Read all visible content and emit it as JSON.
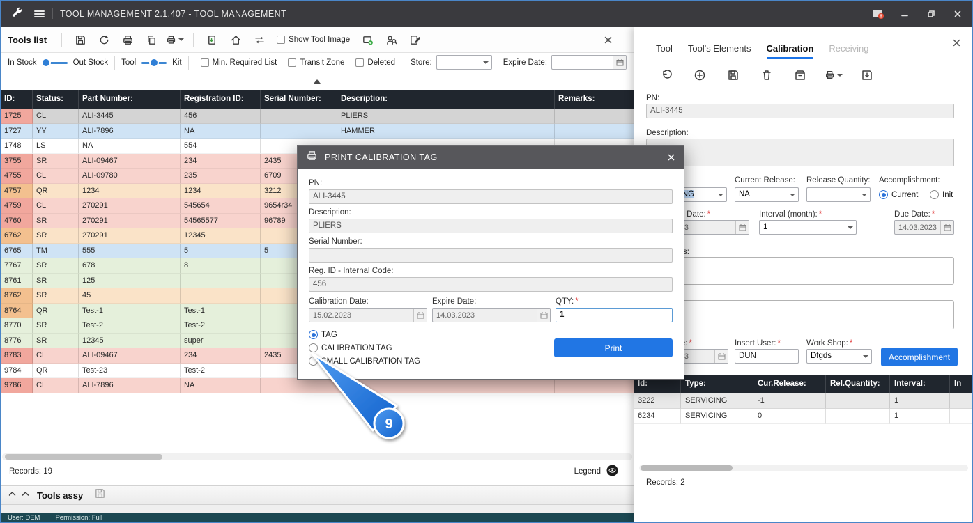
{
  "window": {
    "title": "TOOL MANAGEMENT 2.1.407 - TOOL MANAGEMENT",
    "status_user": "User: DEM",
    "status_permission": "Permission: Full"
  },
  "misc": {
    "star": "*"
  },
  "tools_panel": {
    "title": "Tools list",
    "show_tool_image": "Show Tool Image",
    "filters": {
      "in_stock": "In Stock",
      "out_stock": "Out Stock",
      "tool": "Tool",
      "kit": "Kit",
      "min_required": "Min. Required List",
      "transit_zone": "Transit Zone",
      "deleted": "Deleted",
      "store_label": "Store:",
      "store_value": "",
      "expire_label": "Expire Date:",
      "expire_value": ""
    },
    "records": "Records: 19",
    "legend": "Legend",
    "assy_title": "Tools assy"
  },
  "tools_table": {
    "columns": [
      "ID:",
      "Status:",
      "Part Number:",
      "Registration ID:",
      "Serial Number:",
      "Description:",
      "Remarks:"
    ],
    "rows": [
      {
        "id": "1725",
        "status": "CL",
        "part": "ALI-3445",
        "reg": "456",
        "serial": "",
        "desc": "PLIERS",
        "remarks": "",
        "tone": "selected",
        "id_tone": "salmon"
      },
      {
        "id": "1727",
        "status": "YY",
        "part": "ALI-7896",
        "reg": "NA",
        "serial": "",
        "desc": "HAMMER",
        "remarks": "",
        "tone": "blue",
        "id_tone": "same"
      },
      {
        "id": "1748",
        "status": "LS",
        "part": "NA",
        "reg": "554",
        "serial": "",
        "desc": "",
        "remarks": "",
        "tone": "white",
        "id_tone": "same"
      },
      {
        "id": "3755",
        "status": "SR",
        "part": "ALI-09467",
        "reg": "234",
        "serial": "2435",
        "desc": "",
        "remarks": "",
        "tone": "pink",
        "id_tone": "salmon"
      },
      {
        "id": "4755",
        "status": "CL",
        "part": "ALI-09780",
        "reg": "235",
        "serial": "6709",
        "desc": "",
        "remarks": "",
        "tone": "pink",
        "id_tone": "salmon"
      },
      {
        "id": "4757",
        "status": "QR",
        "part": "1234",
        "reg": "1234",
        "serial": "3212",
        "desc": "",
        "remarks": "",
        "tone": "orange",
        "id_tone": "orange"
      },
      {
        "id": "4759",
        "status": "CL",
        "part": "270291",
        "reg": "545654",
        "serial": "9654r34",
        "desc": "",
        "remarks": "",
        "tone": "pink",
        "id_tone": "salmon"
      },
      {
        "id": "4760",
        "status": "SR",
        "part": "270291",
        "reg": "54565577",
        "serial": "96789",
        "desc": "",
        "remarks": "",
        "tone": "pink",
        "id_tone": "salmon"
      },
      {
        "id": "6762",
        "status": "SR",
        "part": "270291",
        "reg": "12345",
        "serial": "",
        "desc": "",
        "remarks": "",
        "tone": "orange",
        "id_tone": "orange"
      },
      {
        "id": "6765",
        "status": "TM",
        "part": "555",
        "reg": "5",
        "serial": "5",
        "desc": "",
        "remarks": "",
        "tone": "blue",
        "id_tone": "same"
      },
      {
        "id": "7767",
        "status": "SR",
        "part": "678",
        "reg": "8",
        "serial": "",
        "desc": "",
        "remarks": "",
        "tone": "green",
        "id_tone": "same"
      },
      {
        "id": "8761",
        "status": "SR",
        "part": "125",
        "reg": "",
        "serial": "",
        "desc": "",
        "remarks": "",
        "tone": "green",
        "id_tone": "same"
      },
      {
        "id": "8762",
        "status": "SR",
        "part": "45",
        "reg": "",
        "serial": "",
        "desc": "",
        "remarks": "",
        "tone": "orange",
        "id_tone": "orange"
      },
      {
        "id": "8764",
        "status": "QR",
        "part": "Test-1",
        "reg": "Test-1",
        "serial": "",
        "desc": "",
        "remarks": "",
        "tone": "green",
        "id_tone": "orange"
      },
      {
        "id": "8770",
        "status": "SR",
        "part": "Test-2",
        "reg": "Test-2",
        "serial": "",
        "desc": "",
        "remarks": "",
        "tone": "green",
        "id_tone": "same"
      },
      {
        "id": "8776",
        "status": "SR",
        "part": "12345",
        "reg": "super",
        "serial": "",
        "desc": "",
        "remarks": "",
        "tone": "green",
        "id_tone": "same"
      },
      {
        "id": "8783",
        "status": "CL",
        "part": "ALI-09467",
        "reg": "234",
        "serial": "2435",
        "desc": "",
        "remarks": "",
        "tone": "pink",
        "id_tone": "salmon"
      },
      {
        "id": "9784",
        "status": "QR",
        "part": "Test-23",
        "reg": "Test-2",
        "serial": "",
        "desc": "",
        "remarks": "",
        "tone": "white",
        "id_tone": "same"
      },
      {
        "id": "9786",
        "status": "CL",
        "part": "ALI-7896",
        "reg": "NA",
        "serial": "",
        "desc": "",
        "remarks": "",
        "tone": "pink",
        "id_tone": "salmon"
      }
    ]
  },
  "detail_panel": {
    "tabs": [
      "Tool",
      "Tool's Elements",
      "Calibration",
      "Receiving"
    ],
    "active_tab": "Calibration",
    "pn_label": "PN:",
    "pn_value": "ALI-3445",
    "description_label": "Description:",
    "description_value": "",
    "type_value": "SERVICING",
    "current_release_label": "Current Release:",
    "current_release_value": "NA",
    "release_quantity_label": "Release Quantity:",
    "release_quantity_value": "",
    "accomplishment_label": "Accomplishment:",
    "radio_current": "Current",
    "radio_init": "Init",
    "calibration_date_label": "Calibration Date:",
    "calibration_date_value": "15.02.2023",
    "interval_label": "Interval (month):",
    "interval_value": "1",
    "due_date_label": "Due Date:",
    "due_date_value": "14.03.2023",
    "instructions_label": "Instructions:",
    "insert_date_label": "Insert Date:",
    "insert_date_value": "15.02.2023",
    "insert_user_label": "Insert User:",
    "insert_user_value": "DUN",
    "work_shop_label": "Work Shop:",
    "work_shop_value": "Dfgds",
    "accomplishment_button": "Accomplishment",
    "grid": {
      "columns": [
        "Id:",
        "Type:",
        "Cur.Release:",
        "Rel.Quantity:",
        "Interval:",
        "In"
      ],
      "rows": [
        [
          "3222",
          "SERVICING",
          "-1",
          "",
          "1",
          ""
        ],
        [
          "6234",
          "SERVICING",
          "0",
          "",
          "1",
          ""
        ]
      ]
    },
    "records": "Records: 2"
  },
  "dialog": {
    "title": "PRINT CALIBRATION TAG",
    "pn_label": "PN:",
    "pn_value": "ALI-3445",
    "description_label": "Description:",
    "description_value": "PLIERS",
    "serial_label": "Serial Number:",
    "serial_value": "",
    "reg_label": "Reg. ID - Internal Code:",
    "reg_value": "456",
    "calibration_date_label": "Calibration Date:",
    "calibration_date_value": "15.02.2023",
    "expire_date_label": "Expire Date:",
    "expire_date_value": "14.03.2023",
    "qty_label": "QTY:",
    "qty_value": "1",
    "radios": [
      "TAG",
      "CALIBRATION TAG",
      "SMALL CALIBRATION TAG"
    ],
    "selected_radio": "TAG",
    "print_button": "Print"
  },
  "annotation": {
    "step": "9"
  }
}
